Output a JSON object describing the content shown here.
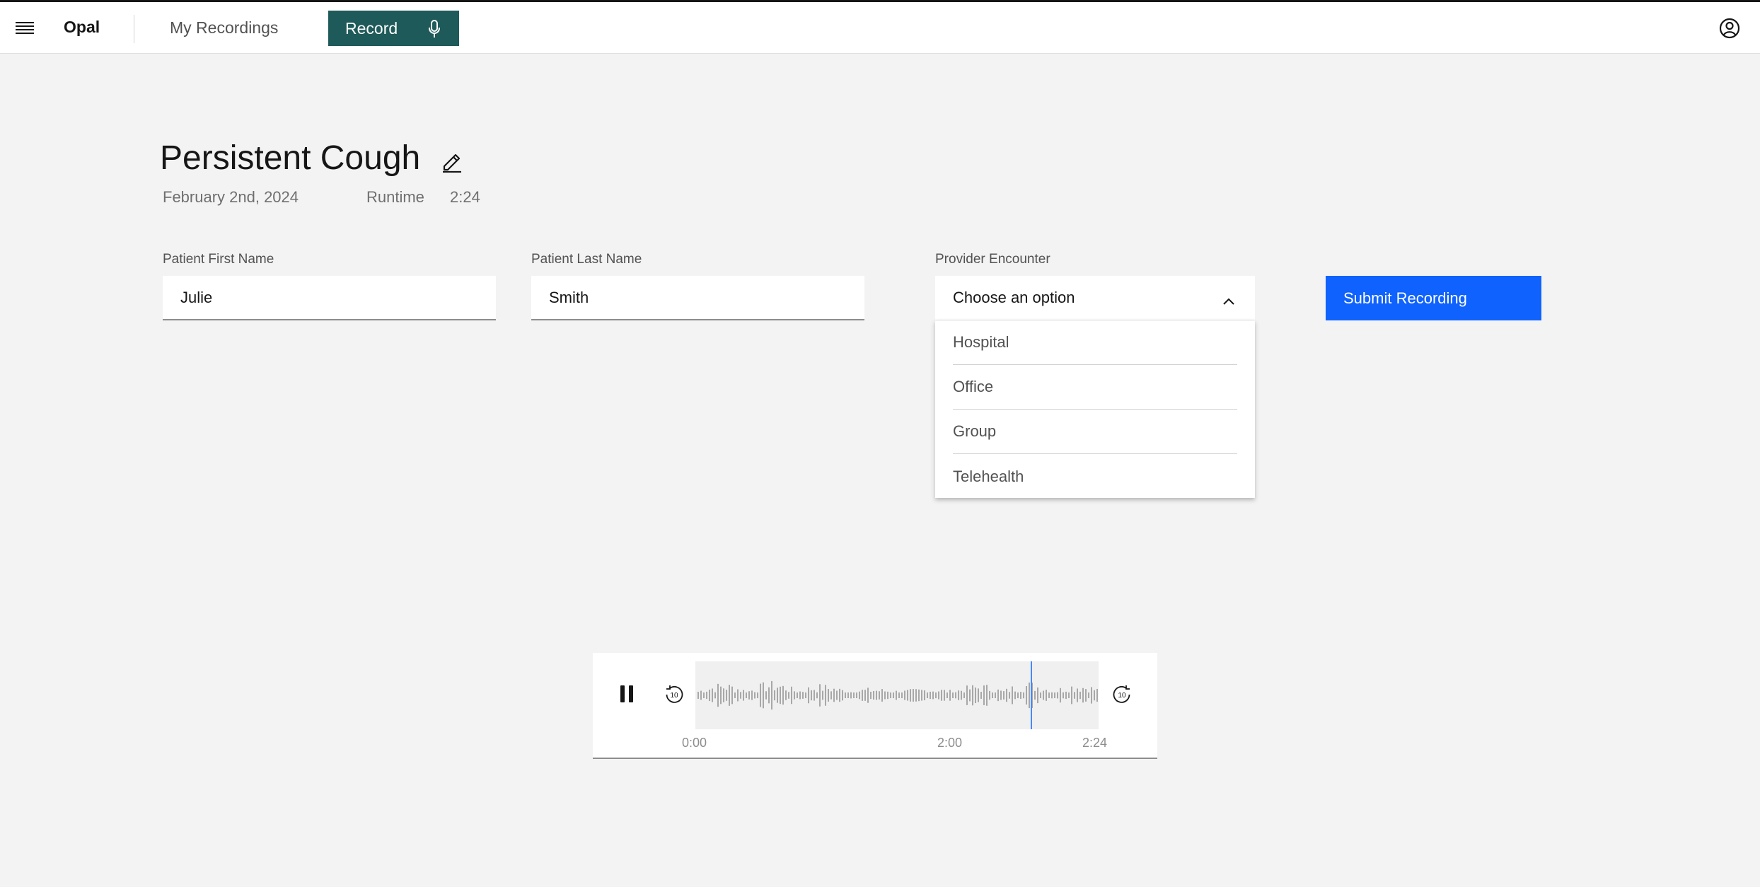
{
  "header": {
    "brand": "Opal",
    "nav_recordings": "My Recordings",
    "record_label": "Record"
  },
  "recording": {
    "title": "Persistent Cough",
    "date": "February 2nd, 2024",
    "runtime_label": "Runtime",
    "runtime_value": "2:24"
  },
  "form": {
    "first_name_label": "Patient First Name",
    "first_name_value": "Julie",
    "last_name_label": "Patient Last Name",
    "last_name_value": "Smith",
    "encounter_label": "Provider Encounter",
    "encounter_placeholder": "Choose an option",
    "encounter_options": [
      "Hospital",
      "Office",
      "Group",
      "Telehealth"
    ],
    "submit_label": "Submit Recording"
  },
  "player": {
    "state": "playing",
    "start_time": "0:00",
    "current_time": "2:00",
    "end_time": "2:24",
    "skip_seconds": 10,
    "playhead_color": "#4589ff"
  },
  "colors": {
    "accent": "#0f62fe",
    "record": "#1f5a5a"
  }
}
